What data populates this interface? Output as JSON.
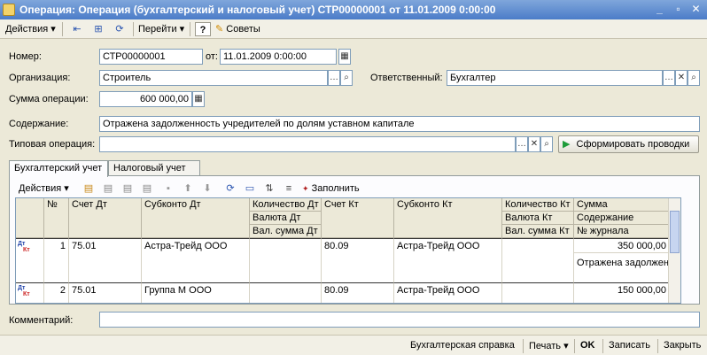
{
  "window": {
    "title": "Операция: Операция (бухгалтерский и налоговый учет) СТР00000001 от 11.01.2009 0:00:00",
    "controls": [
      "_",
      "▫",
      "✕"
    ]
  },
  "toolbar": {
    "actions_label": "Действия",
    "goto_label": "Перейти",
    "help_label": "?",
    "tips_label": "Советы"
  },
  "form": {
    "number_label": "Номер:",
    "number_value": "СТР00000001",
    "from_label": "от:",
    "date_value": "11.01.2009  0:00:00",
    "org_label": "Организация:",
    "org_value": "Строитель",
    "responsible_label": "Ответственный:",
    "responsible_value": "Бухгалтер",
    "sum_label": "Сумма операции:",
    "sum_value": "600 000,00",
    "content_label": "Содержание:",
    "content_value": "Отражена задолженность учредителей по долям уставном капитале",
    "typical_label": "Типовая операция:",
    "typical_value": "",
    "generate_button": "Сформировать проводки"
  },
  "tabs": [
    {
      "label": "Бухгалтерский учет",
      "active": true
    },
    {
      "label": "Налоговый учет",
      "active": false
    }
  ],
  "inner_toolbar": {
    "actions_label": "Действия",
    "fill_label": "Заполнить"
  },
  "grid": {
    "headers": {
      "num": "№",
      "debit_account": "Счет Дт",
      "debit_subconto": "Субконто Дт",
      "debit_qty": "Количество Дт",
      "debit_currency": "Валюта Дт",
      "debit_cur_sum": "Вал. сумма Дт",
      "credit_account": "Счет Кт",
      "credit_subconto": "Субконто Кт",
      "credit_qty": "Количество Кт",
      "credit_currency": "Валюта Кт",
      "credit_cur_sum": "Вал. сумма Кт",
      "sum": "Сумма",
      "content": "Содержание",
      "journal": "№ журнала"
    },
    "row_icon_top": "Дт",
    "row_icon_bottom": "Кт",
    "rows": [
      {
        "num": "1",
        "debit_account": "75.01",
        "debit_subconto": "Астра-Трейд ООО",
        "credit_account": "80.09",
        "credit_subconto": "Астра-Трейд ООО",
        "sum": "350 000,00",
        "content": "Отражена задолженн..."
      },
      {
        "num": "2",
        "debit_account": "75.01",
        "debit_subconto": "Группа М ООО",
        "credit_account": "80.09",
        "credit_subconto": "Астра-Трейд ООО",
        "sum": "150 000,00",
        "content": ""
      }
    ]
  },
  "comment": {
    "label": "Комментарий:",
    "value": ""
  },
  "statusbar": {
    "report_label": "Бухгалтерская справка",
    "print_label": "Печать",
    "ok_label": "OK",
    "save_label": "Записать",
    "close_label": "Закрыть"
  },
  "colors": {
    "title_gradient_top": "#7FA6DB",
    "title_gradient_bottom": "#4B7CC8",
    "background": "#ECE9D8",
    "generate_icon": "#1E9C3A",
    "debit_icon": "#2244AA",
    "credit_icon": "#CC2222"
  },
  "icons": {
    "title": "document-icon",
    "generate": "play-icon",
    "tips": "lightbulb-icon",
    "help": "question-icon"
  }
}
